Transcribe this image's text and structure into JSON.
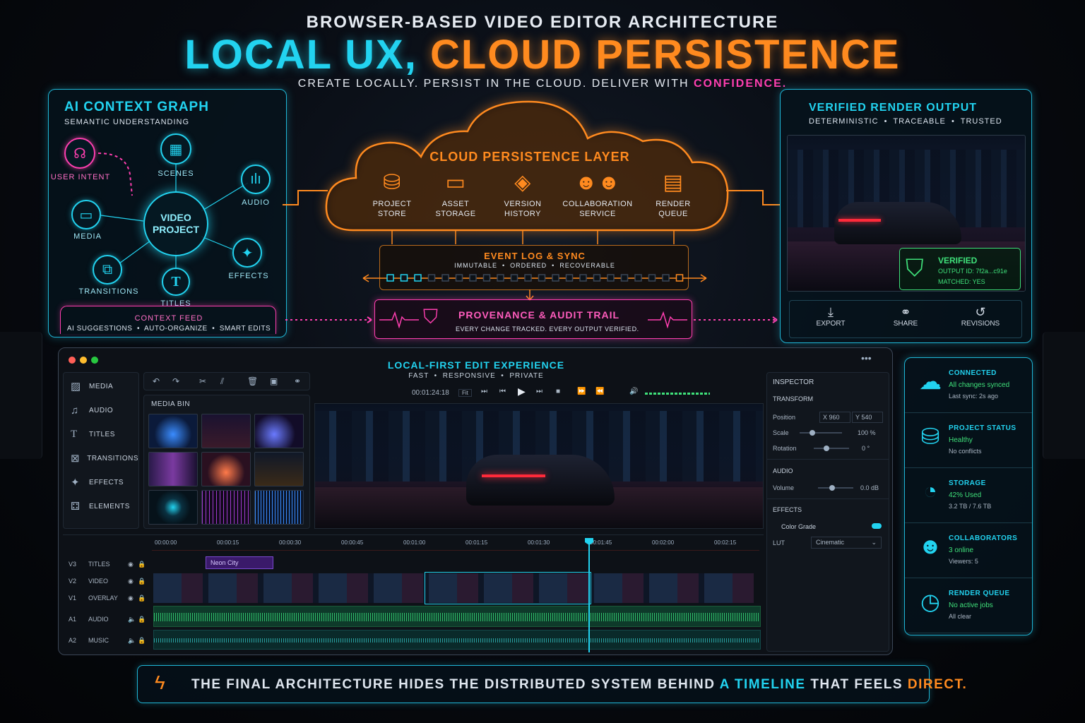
{
  "header": {
    "top": "BROWSER-BASED VIDEO EDITOR ARCHITECTURE",
    "title_a": "LOCAL UX,",
    "title_b": "CLOUD PERSISTENCE",
    "subtitle": "CREATE LOCALLY. PERSIST IN THE CLOUD. DELIVER WITH",
    "subtitle_accent": "CONFIDENCE."
  },
  "ai_graph": {
    "title": "AI CONTEXT GRAPH",
    "subtitle": "SEMANTIC UNDERSTANDING",
    "center": "VIDEO PROJECT",
    "nodes": {
      "user_intent": "USER INTENT",
      "scenes": "SCENES",
      "audio": "AUDIO",
      "media": "MEDIA",
      "effects": "EFFECTS",
      "transitions": "TRANSITIONS",
      "titles": "TITLES"
    },
    "feed_title": "CONTEXT FEED",
    "feed_items": "AI SUGGESTIONS  •  AUTO-ORGANIZE  •  SMART EDITS"
  },
  "cloud": {
    "title": "CLOUD PERSISTENCE LAYER",
    "items": [
      {
        "l1": "PROJECT",
        "l2": "STORE"
      },
      {
        "l1": "ASSET",
        "l2": "STORAGE"
      },
      {
        "l1": "VERSION",
        "l2": "HISTORY"
      },
      {
        "l1": "COLLABORATION",
        "l2": "SERVICE"
      },
      {
        "l1": "RENDER",
        "l2": "QUEUE"
      }
    ],
    "event_title": "EVENT LOG & SYNC",
    "event_sub": "IMMUTABLE  •  ORDERED  •  RECOVERABLE",
    "prov_title": "PROVENANCE & AUDIT TRAIL",
    "prov_sub": "EVERY CHANGE TRACKED. EVERY OUTPUT VERIFIED."
  },
  "render": {
    "title": "VERIFIED RENDER OUTPUT",
    "subtitle": "DETERMINISTIC  •  TRACEABLE  •  TRUSTED",
    "verified": "VERIFIED",
    "output_id": "OUTPUT ID: 7f2a...c91e",
    "matched": "MATCHED: YES",
    "actions": [
      "EXPORT",
      "SHARE",
      "REVISIONS"
    ]
  },
  "editor": {
    "title": "LOCAL-FIRST EDIT EXPERIENCE",
    "subtitle": "FAST  •  RESPONSIVE  •  PRIVATE",
    "sidebar": [
      "MEDIA",
      "AUDIO",
      "TITLES",
      "TRANSITIONS",
      "EFFECTS",
      "ELEMENTS"
    ],
    "media_bin": "MEDIA BIN",
    "timecode": "00:01:24:18",
    "fit": "Fit",
    "ruler": [
      "00:00:00",
      "00:00:15",
      "00:00:30",
      "00:00:45",
      "00:01:00",
      "00:01:15",
      "00:01:30",
      "00:01:45",
      "00:02:00",
      "00:02:15"
    ],
    "tracks": [
      {
        "id": "V3",
        "name": "TITLES"
      },
      {
        "id": "V2",
        "name": "VIDEO"
      },
      {
        "id": "V1",
        "name": "OVERLAY"
      },
      {
        "id": "A1",
        "name": "AUDIO"
      },
      {
        "id": "A2",
        "name": "MUSIC"
      }
    ],
    "title_clip": "Neon City",
    "inspector": {
      "title": "INSPECTOR",
      "transform": "TRANSFORM",
      "position": "Position",
      "pos_x_label": "X",
      "pos_x": "960",
      "pos_y_label": "Y",
      "pos_y": "540",
      "scale": "Scale",
      "scale_val": "100",
      "scale_unit": "%",
      "rotation": "Rotation",
      "rotation_val": "0",
      "rotation_unit": "°",
      "audio": "AUDIO",
      "volume": "Volume",
      "volume_val": "0.0",
      "volume_unit": "dB",
      "effects": "EFFECTS",
      "color_grade": "Color Grade",
      "lut": "LUT",
      "lut_val": "Cinematic"
    }
  },
  "status": [
    {
      "icon": "cloud-icon",
      "title": "CONNECTED",
      "status": "All changes synced",
      "detail": "Last sync: 2s ago"
    },
    {
      "icon": "database-icon",
      "title": "PROJECT STATUS",
      "status": "Healthy",
      "detail": "No conflicts"
    },
    {
      "icon": "pie-icon",
      "title": "STORAGE",
      "status": "42% Used",
      "detail": "3.2 TB / 7.6 TB"
    },
    {
      "icon": "users-icon",
      "title": "COLLABORATORS",
      "status": "3 online",
      "detail": "Viewers: 5"
    },
    {
      "icon": "clock-icon",
      "title": "RENDER QUEUE",
      "status": "No active jobs",
      "detail": "All clear"
    }
  ],
  "footer": {
    "text": "THE FINAL ARCHITECTURE HIDES THE DISTRIBUTED SYSTEM BEHIND",
    "accent1": "A TIMELINE",
    "mid": "THAT FEELS",
    "accent2": "DIRECT."
  }
}
